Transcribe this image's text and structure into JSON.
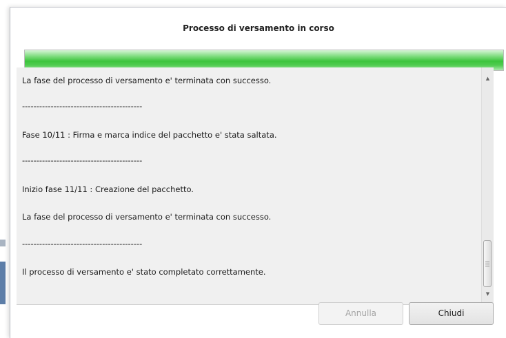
{
  "dialog": {
    "title": "Processo di versamento in corso",
    "progress_fraction": 1.0,
    "progress_color": "#3cc43c"
  },
  "log": {
    "lines": [
      "La fase del processo di versamento e' terminata con successo.",
      "------------------------------------------",
      "Fase 10/11 : Firma e marca indice del pacchetto e' stata saltata.",
      "------------------------------------------",
      "Inizio fase 11/11 : Creazione del pacchetto.",
      "La fase del processo di versamento e' terminata con successo.",
      "------------------------------------------",
      "Il processo di versamento e' stato completato correttamente."
    ]
  },
  "buttons": {
    "cancel_label": "Annulla",
    "close_label": "Chiudi"
  },
  "icons": {
    "scroll_up": "triangle-up-icon",
    "scroll_down": "triangle-down-icon",
    "scroll_grip": "grip-lines-icon"
  }
}
